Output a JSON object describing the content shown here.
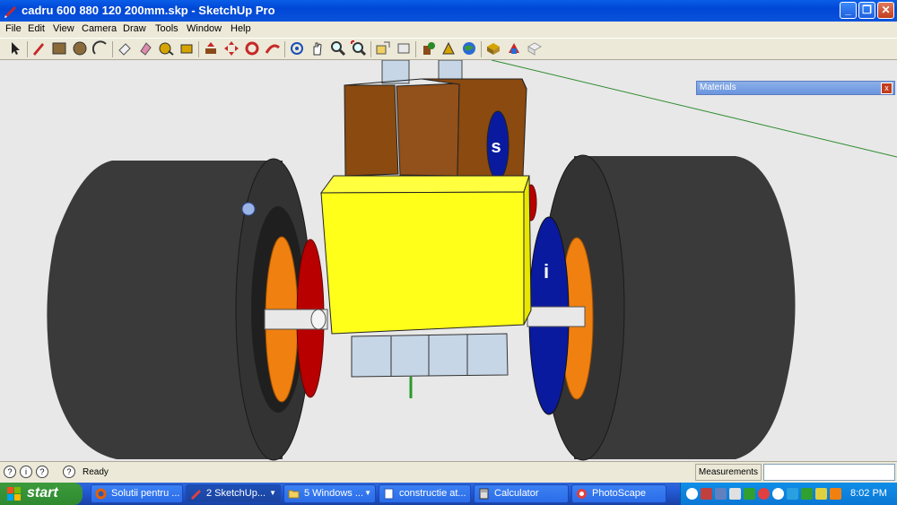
{
  "window": {
    "title": "cadru 600 880 120 200mm.skp - SketchUp Pro",
    "minimize_label": "_",
    "maximize_label": "❐",
    "close_label": "✕"
  },
  "menu": [
    "File",
    "Edit",
    "View",
    "Camera",
    "Draw",
    "Tools",
    "Window",
    "Help"
  ],
  "toolbar": {
    "icons": [
      "select-icon",
      "pencil-icon",
      "rectangle-icon",
      "circle-icon",
      "arc-icon",
      "eraser-icon",
      "paint-icon",
      "tape-measure-icon",
      "dimension-icon",
      "push-pull-icon",
      "move-icon",
      "rotate-icon",
      "follow-me-icon",
      "orbit-icon",
      "pan-icon",
      "zoom-icon",
      "zoom-extents-icon",
      "get-models-icon",
      "share-model-icon",
      "share-component-icon",
      "photo-textures-icon",
      "google-earth-icon",
      "components-icon",
      "materials-icon",
      "styles-icon"
    ]
  },
  "materials_panel": {
    "title": "Materials",
    "close_label": "x"
  },
  "scene": {
    "label_s": "s",
    "label_i": "i",
    "colors": {
      "tire": "#3a3a3a",
      "orange": "#f08010",
      "red": "#b80000",
      "blue": "#0a1a9e",
      "yellow": "#ffff1a",
      "brown": "#8a4a10",
      "axle": "#e8e8e8",
      "bottom": "#c6d6e6"
    }
  },
  "statusbar": {
    "ready": "Ready",
    "measurements_label": "Measurements",
    "measurements_value": ""
  },
  "taskbar": {
    "start": "start",
    "tasks": [
      {
        "label": "Solutii pentru ...",
        "icon": "firefox-icon"
      },
      {
        "label": "2 SketchUp...",
        "icon": "sketchup-icon"
      },
      {
        "label": "5 Windows ...",
        "icon": "folder-icon"
      },
      {
        "label": "constructie at...",
        "icon": "document-icon"
      },
      {
        "label": "Calculator",
        "icon": "calculator-icon"
      },
      {
        "label": "PhotoScape",
        "icon": "photoscape-icon"
      }
    ],
    "clock": "8:02 PM"
  }
}
